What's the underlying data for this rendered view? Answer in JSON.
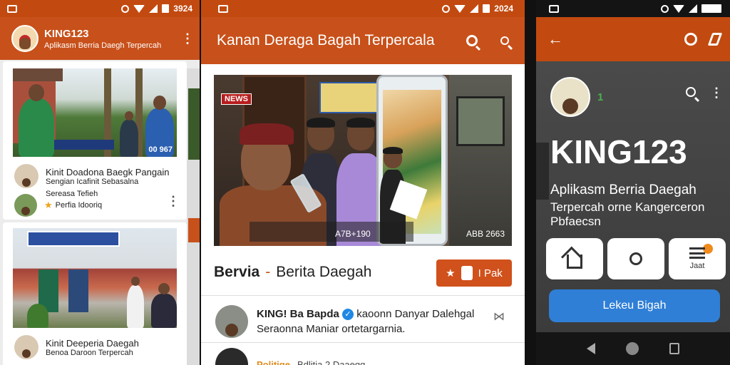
{
  "phone1": {
    "status_time": "3924",
    "app_title": "KING123",
    "app_subtitle": "Aplikasm Berria Daegh Terpercah",
    "card1": {
      "image_counter": "00 967",
      "headline": "Kinit Doadona Baegk Pangain",
      "line2": "Sengian Icafinit Sebasalna",
      "line3": "Sereasa Tefieh",
      "tag": "Perfia Idooriq"
    },
    "card2": {
      "headline": "Kinit Deeperia Daegah",
      "line2": "Benoa Daroon Terpercah"
    }
  },
  "phone2": {
    "status_time": "2024",
    "title": "Kanan Deraga Bagah Terpercala",
    "hero_tag": "NEWS",
    "hero_caption_left": "A7B+190",
    "hero_caption_right": "ABB 2663",
    "section_title_a": "Bervia",
    "section_title_b": "Berita Daegah",
    "section_dash": "-",
    "pak_label": "I Pak",
    "post": {
      "author": "KING! Ba Bapda",
      "text_a": "kaoonn Danyar Dalehgal",
      "text_b": "Seraonna Maniar ortetargarnia.",
      "badge": "✓"
    },
    "post2": {
      "category": "Politige",
      "meta": "Bdlitia 2 Daaegg"
    }
  },
  "phone3": {
    "status_time": "",
    "badge_count": "1",
    "big_title": "KING123",
    "subtitle": "Aplikasm Berria Daegah",
    "subtitle2": "Terpercah orne Kangerceron Pbfaecsn",
    "btn_menu_label": "Jaat",
    "cta_label": "Lekeu Bigah"
  },
  "colors": {
    "brand_orange": "#c8501a",
    "cta_blue": "#2f7fd6",
    "star_gold": "#f1a21b"
  }
}
